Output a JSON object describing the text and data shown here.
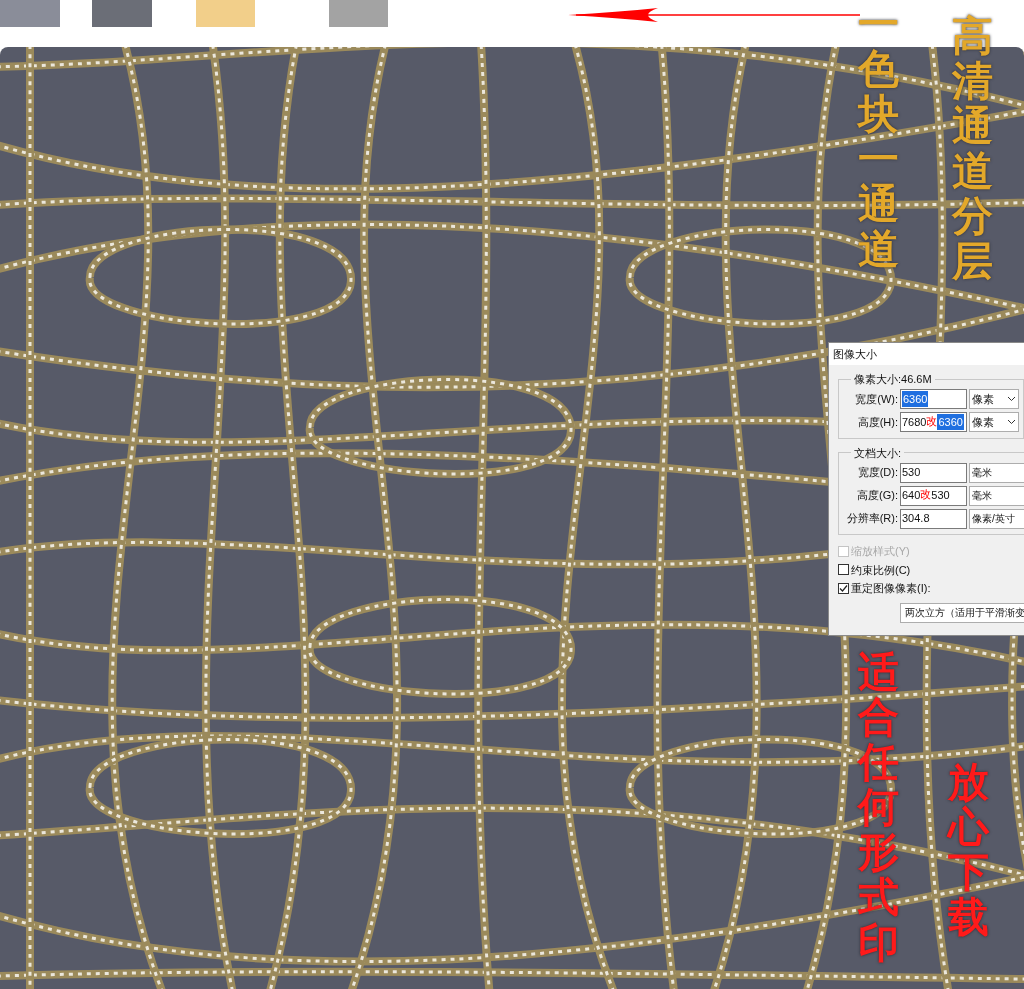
{
  "swatches": [
    {
      "color": "#8a8d99"
    },
    {
      "color": "#6b6e77"
    },
    {
      "color": "#f2cf8a"
    },
    {
      "color": "#a3a3a3"
    }
  ],
  "captions": [
    {
      "text": "一色块一通道",
      "color": "#e3a82a"
    },
    {
      "text": "高清通道分层",
      "color": "#e3a82a"
    },
    {
      "text": "适合任何形式印",
      "color": "#ff1a1a"
    },
    {
      "text": "放心下载",
      "color": "#ff1a1a"
    }
  ],
  "dialog": {
    "title": "图像大小",
    "groups": [
      {
        "kind": "pixel_size",
        "legend": "像素大小:46.6M",
        "fields": [
          {
            "label": "宽度(W):",
            "value": "6360",
            "value_selected": true,
            "unit": "像素"
          },
          {
            "label": "高度(H):",
            "old_value": "7680",
            "mark": "改",
            "value": "6360",
            "value_selected": true,
            "unit": "像素"
          }
        ]
      },
      {
        "kind": "document_size",
        "legend": "文档大小:",
        "fields": [
          {
            "label": "宽度(D):",
            "value": "530",
            "value_selected": false,
            "unit": "毫米"
          },
          {
            "label": "高度(G):",
            "old_value": "640",
            "mark": "改",
            "value": "530",
            "value_selected": false,
            "unit": "毫米"
          },
          {
            "label": "分辨率(R):",
            "value": "304.8",
            "value_selected": false,
            "unit": "像素/英寸"
          }
        ]
      }
    ],
    "checkboxes": [
      {
        "label": "缩放样式(Y)",
        "checked": false,
        "disabled": true
      },
      {
        "label": "约束比例(C)",
        "checked": false,
        "disabled": false
      },
      {
        "label": "重定图像像素(I):",
        "checked": true,
        "disabled": false
      }
    ],
    "resample": "两次立方（适用于平滑渐变"
  }
}
